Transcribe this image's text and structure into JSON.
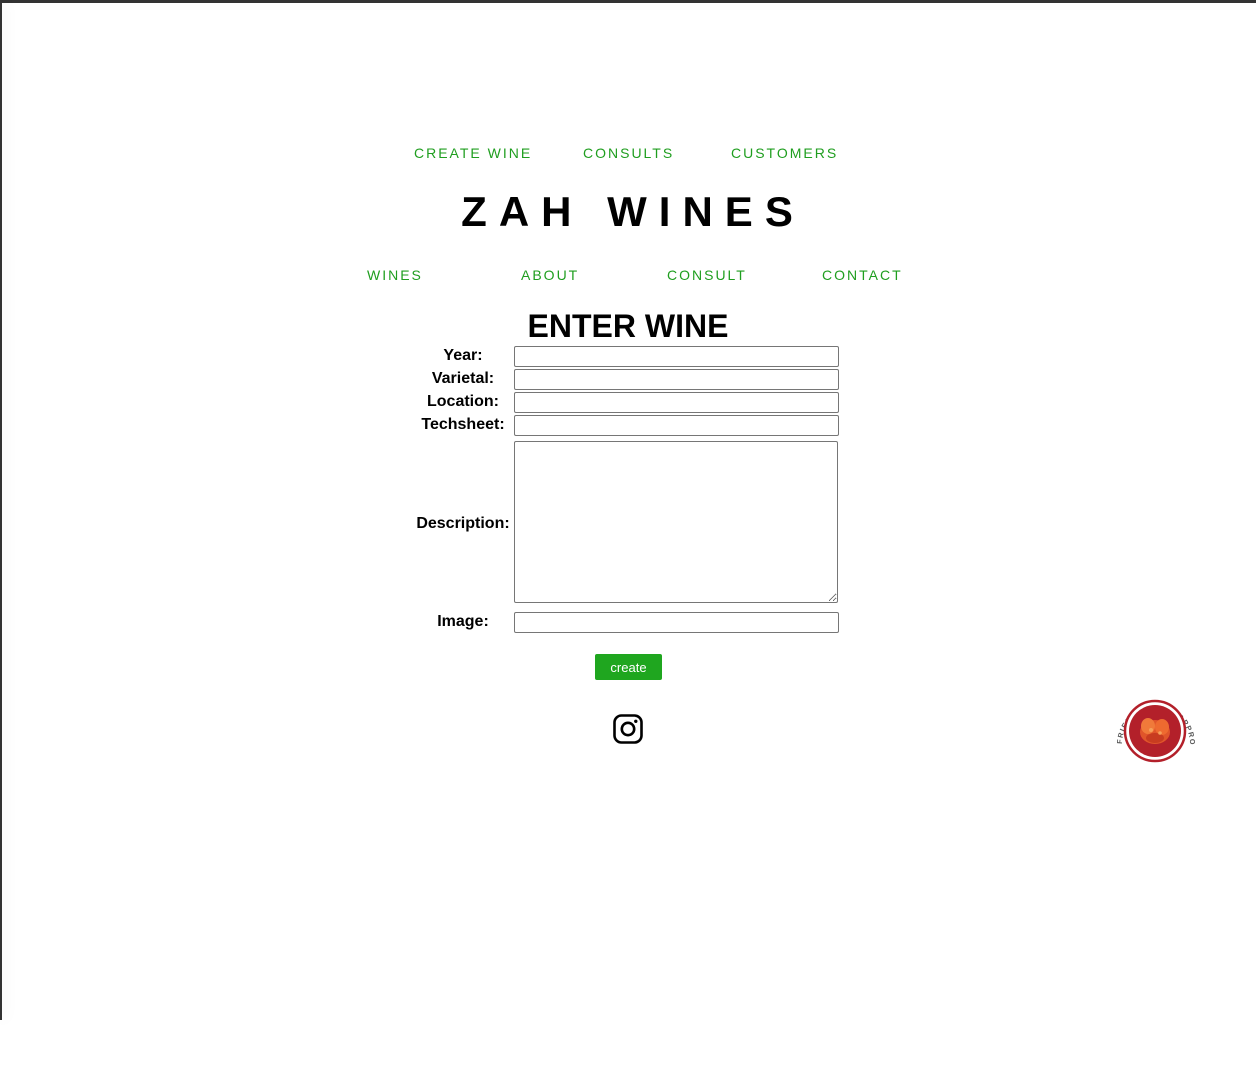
{
  "admin_nav": {
    "create_wine": "CREATE WINE",
    "consults": "CONSULTS",
    "customers": "CUSTOMERS"
  },
  "brand": {
    "title": "ZAH WINES"
  },
  "main_nav": {
    "wines": "WINES",
    "about": "ABOUT",
    "consult": "CONSULT",
    "contact": "CONTACT"
  },
  "form": {
    "title": "ENTER WINE",
    "fields": {
      "year_label": "Year:",
      "year_value": "",
      "varietal_label": "Varietal:",
      "varietal_value": "",
      "location_label": "Location:",
      "location_value": "",
      "techsheet_label": "Techsheet:",
      "techsheet_value": "",
      "description_label": "Description:",
      "description_value": "",
      "image_label": "Image:",
      "image_value": ""
    },
    "submit_label": "create"
  },
  "footer": {
    "social_icon": "instagram-icon",
    "badge_text": "FRIED CHICKEN APPROVED"
  },
  "colors": {
    "accent": "#1f9e1f",
    "button": "#1fa61f",
    "badge_red": "#b3202a"
  }
}
